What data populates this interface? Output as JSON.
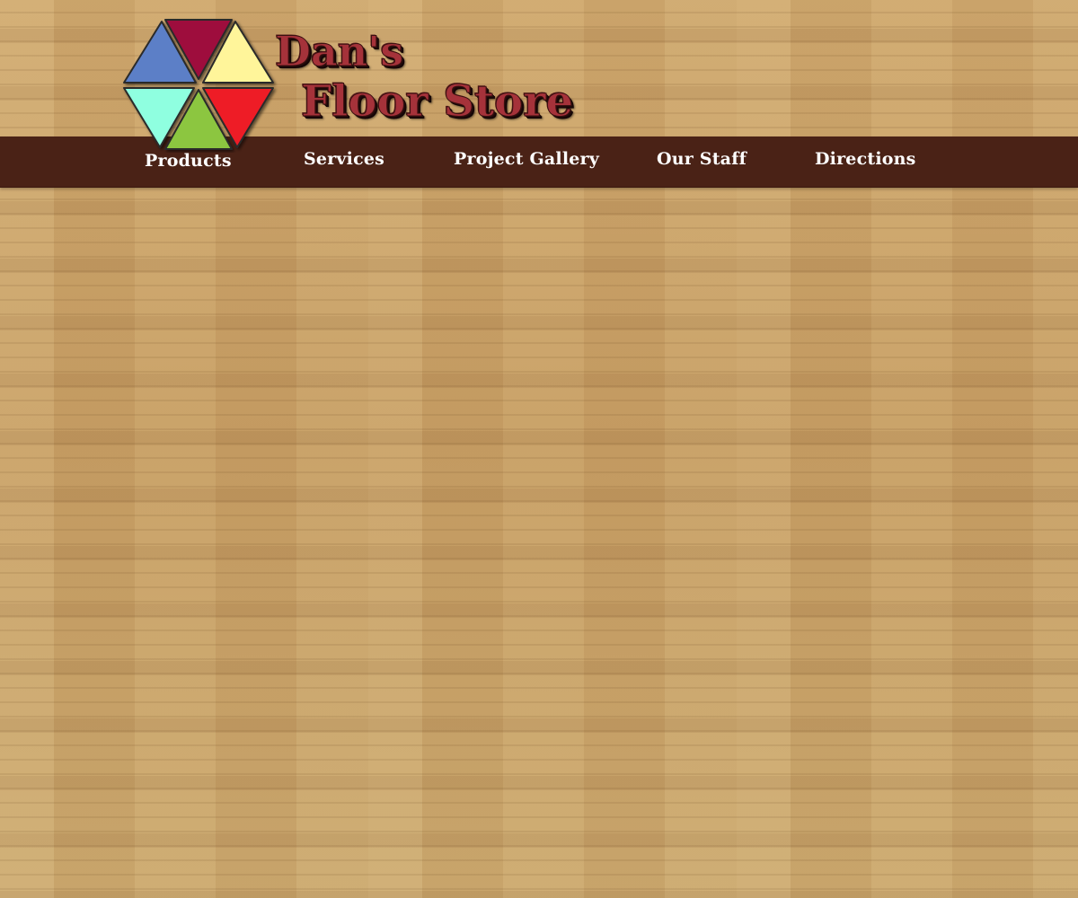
{
  "header": {
    "brand_line1": "Dan's",
    "brand_line2": "Floor Store",
    "logo_icon": "hexagon-triangles-logo-icon"
  },
  "nav": {
    "items": [
      {
        "label": "Products"
      },
      {
        "label": "Services"
      },
      {
        "label": "Project Gallery"
      },
      {
        "label": "Our Staff"
      },
      {
        "label": "Directions"
      }
    ]
  },
  "colors": {
    "navbar": "#4a2216",
    "brand_text": "#a5323a",
    "logo_blue": "#5b7fc7",
    "logo_maroon": "#9e0b3c",
    "logo_yellow": "#fff59a",
    "logo_cyan": "#8fffe0",
    "logo_green": "#8cc63f",
    "logo_red": "#ee1c25"
  }
}
